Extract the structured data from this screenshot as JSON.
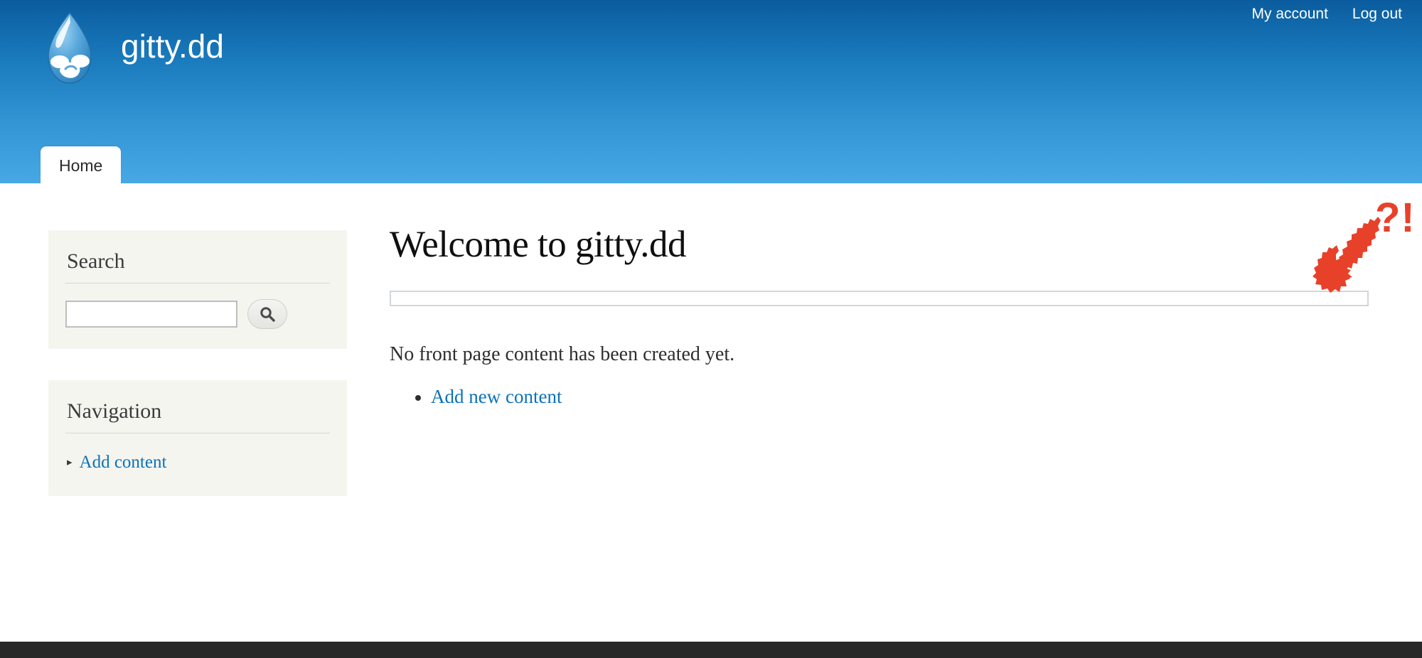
{
  "header": {
    "site_name": "gitty.dd",
    "logo_icon": "drupal-droplet-logo",
    "user_links": [
      {
        "label": "My account"
      },
      {
        "label": "Log out"
      }
    ],
    "tabs": [
      {
        "label": "Home",
        "active": true
      }
    ],
    "gradient_top_color": "#0a5c9e",
    "gradient_bottom_color": "#47a8e5"
  },
  "sidebar": {
    "search_block": {
      "title": "Search",
      "input_value": "",
      "input_placeholder": "",
      "button_icon": "search-icon"
    },
    "navigation_block": {
      "title": "Navigation",
      "items": [
        {
          "label": "Add content",
          "bullet_icon": "triangle-right-icon"
        }
      ]
    },
    "block_background": "#f5f5f0"
  },
  "content": {
    "page_title": "Welcome to gitty.dd",
    "empty_region_present": true,
    "message": "No front page content has been created yet.",
    "actions": [
      {
        "label": "Add new content"
      }
    ],
    "link_color": "#0b72b9"
  },
  "annotation": {
    "mark": "?!",
    "color": "#e8412a",
    "arrow_icon": "hand-drawn-arrow-down-left-icon"
  },
  "footer": {
    "background": "#282828"
  }
}
